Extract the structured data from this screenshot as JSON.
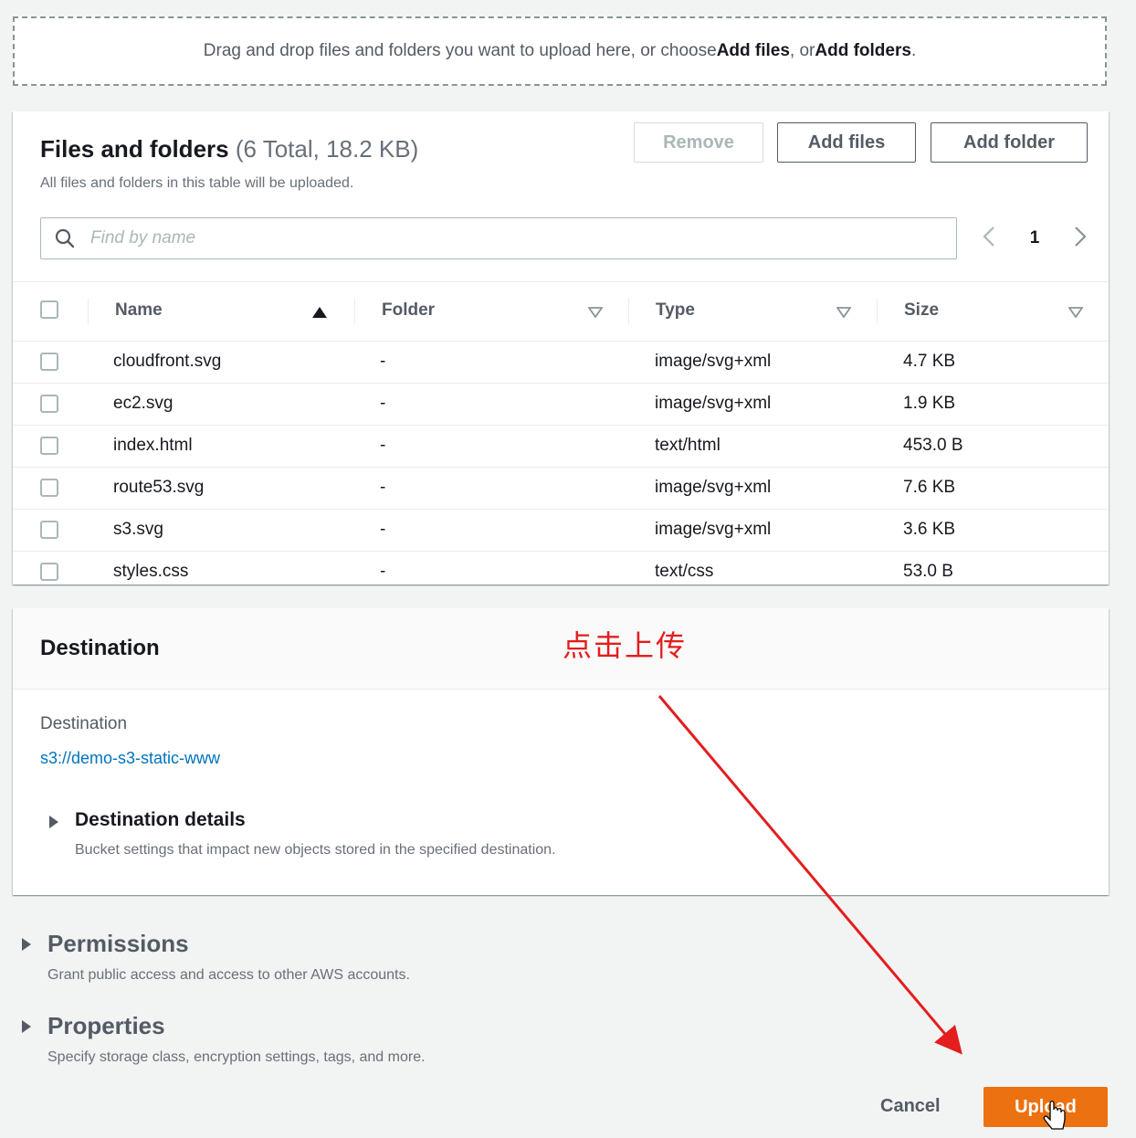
{
  "dropzone": {
    "text_before": "Drag and drop files and folders you want to upload here, or choose ",
    "add_files": "Add files",
    "text_mid": ", or ",
    "add_folders": "Add folders",
    "text_after": "."
  },
  "files": {
    "title": "Files and folders",
    "count": "(6 Total, 18.2 KB)",
    "description": "All files and folders in this table will be uploaded.",
    "remove_label": "Remove",
    "add_files_label": "Add files",
    "add_folder_label": "Add folder",
    "search_placeholder": "Find by name",
    "page": "1",
    "columns": [
      "Name",
      "Folder",
      "Type",
      "Size"
    ],
    "rows": [
      {
        "name": "cloudfront.svg",
        "folder": "-",
        "type": "image/svg+xml",
        "size": "4.7 KB"
      },
      {
        "name": "ec2.svg",
        "folder": "-",
        "type": "image/svg+xml",
        "size": "1.9 KB"
      },
      {
        "name": "index.html",
        "folder": "-",
        "type": "text/html",
        "size": "453.0 B"
      },
      {
        "name": "route53.svg",
        "folder": "-",
        "type": "image/svg+xml",
        "size": "7.6 KB"
      },
      {
        "name": "s3.svg",
        "folder": "-",
        "type": "image/svg+xml",
        "size": "3.6 KB"
      },
      {
        "name": "styles.css",
        "folder": "-",
        "type": "text/css",
        "size": "53.0 B"
      }
    ]
  },
  "destination": {
    "title": "Destination",
    "label": "Destination",
    "link": "s3://demo-s3-static-www",
    "details_title": "Destination details",
    "details_desc": "Bucket settings that impact new objects stored in the specified destination."
  },
  "annotation": "点击上传",
  "permissions": {
    "title": "Permissions",
    "desc": "Grant public access and access to other AWS accounts."
  },
  "properties": {
    "title": "Properties",
    "desc": "Specify storage class, encryption settings, tags, and more."
  },
  "footer": {
    "cancel_label": "Cancel",
    "upload_label": "Upload"
  },
  "colors": {
    "accent": "#ec7211",
    "link": "#0073bb",
    "annotation": "#e41d1d"
  }
}
